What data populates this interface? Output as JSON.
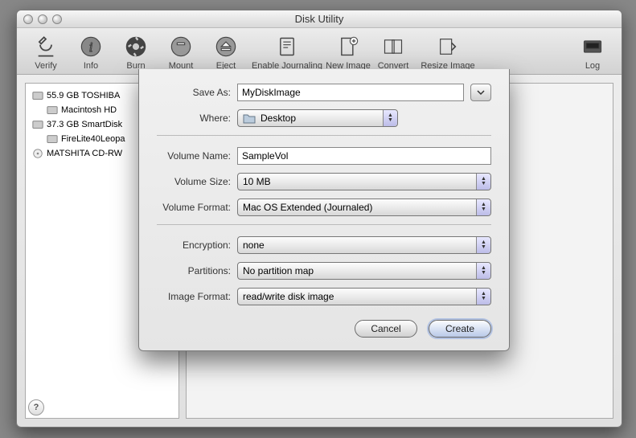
{
  "window": {
    "title": "Disk Utility"
  },
  "toolbar": {
    "verify": "Verify",
    "info": "Info",
    "burn": "Burn",
    "mount": "Mount",
    "eject": "Eject",
    "enable_journaling": "Enable Journaling",
    "new_image": "New Image",
    "convert": "Convert",
    "resize_image": "Resize Image",
    "log": "Log"
  },
  "sidebar": {
    "items": [
      {
        "label": "55.9 GB TOSHIBA",
        "indent": 0,
        "icon": "hdd"
      },
      {
        "label": "Macintosh HD",
        "indent": 1,
        "icon": "hdd"
      },
      {
        "label": "37.3 GB SmartDisk",
        "indent": 0,
        "icon": "hdd"
      },
      {
        "label": "FireLite40Leopa",
        "indent": 1,
        "icon": "hdd"
      },
      {
        "label": "MATSHITA CD-RW",
        "indent": 0,
        "icon": "optical"
      }
    ]
  },
  "sheet": {
    "save_as_label": "Save As:",
    "save_as_value": "MyDiskImage",
    "where_label": "Where:",
    "where_value": "Desktop",
    "volume_name_label": "Volume Name:",
    "volume_name_value": "SampleVol",
    "volume_size_label": "Volume Size:",
    "volume_size_value": "10 MB",
    "volume_format_label": "Volume Format:",
    "volume_format_value": "Mac OS Extended (Journaled)",
    "encryption_label": "Encryption:",
    "encryption_value": "none",
    "partitions_label": "Partitions:",
    "partitions_value": "No partition map",
    "image_format_label": "Image Format:",
    "image_format_value": "read/write disk image",
    "cancel": "Cancel",
    "create": "Create"
  },
  "help_glyph": "?"
}
